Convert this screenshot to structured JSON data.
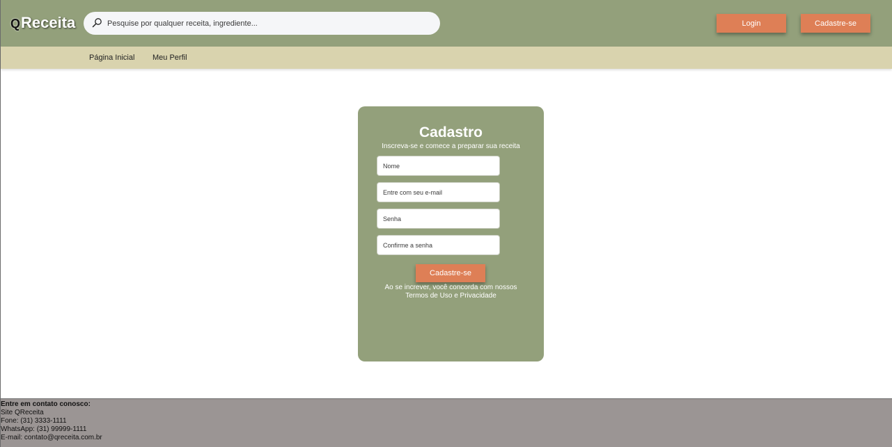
{
  "header": {
    "logo_q": "Q",
    "logo_text": "Receita",
    "search": {
      "placeholder": "Pesquise por qualquer receita, ingrediente...",
      "icon": "search-icon"
    },
    "login_label": "Login",
    "signup_label": "Cadastre-se"
  },
  "nav": {
    "items": [
      {
        "label": "Página Inicial"
      },
      {
        "label": "Meu Perfil"
      }
    ]
  },
  "form": {
    "title": "Cadastro",
    "subtitle": "Inscreva-se e comece a preparar sua receita",
    "fields": [
      {
        "placeholder": "Nome"
      },
      {
        "placeholder": "Entre com seu e-mail"
      },
      {
        "placeholder": "Senha"
      },
      {
        "placeholder": "Confirme a senha"
      }
    ],
    "submit_label": "Cadastre-se",
    "terms_line1": "Ao se increver, você concorda com nossos",
    "terms_line2": "Termos de Uso e Privacidade"
  },
  "footer": {
    "heading": "Entre em contato conosco:",
    "lines": [
      "Site QReceita",
      "Fone: (31) 3333-1111",
      "WhatsApp: (31) 99999-1111",
      "E-mail: contato@qreceita.com.br"
    ]
  },
  "colors": {
    "header_bg": "#93a07b",
    "nav_bg": "#d9d3ae",
    "accent": "#de7f56",
    "footer_bg": "#9b9594"
  }
}
